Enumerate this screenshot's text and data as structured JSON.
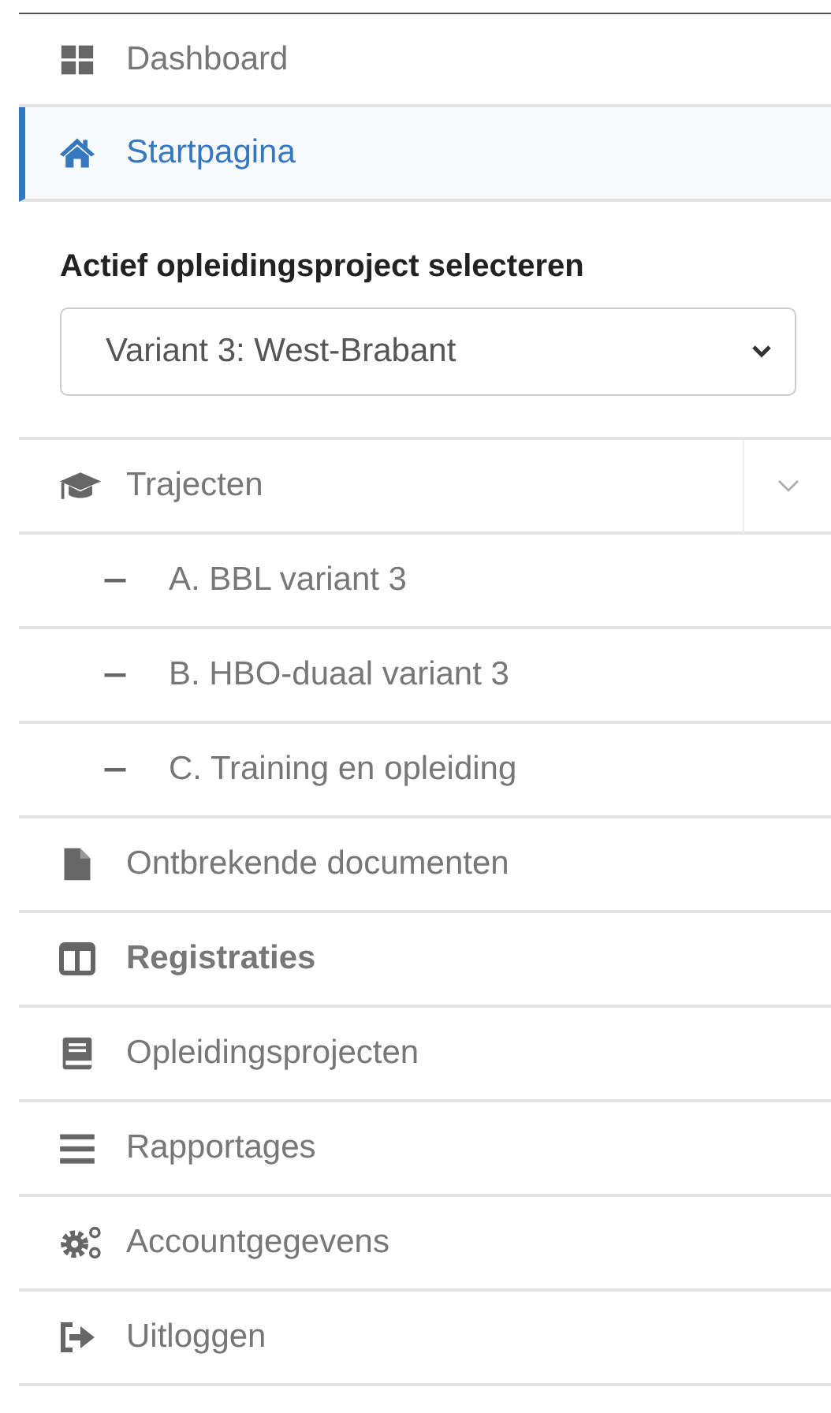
{
  "top_items": [
    {
      "label": "Dashboard",
      "selected": false
    },
    {
      "label": "Startpagina",
      "selected": true
    }
  ],
  "project_selector": {
    "label": "Actief opleidingsproject selecteren",
    "value": "Variant 3: West-Brabant"
  },
  "items": [
    {
      "label": "Trajecten",
      "selected": false,
      "bold": false,
      "expanded": true,
      "children": [
        {
          "label": "A. BBL variant 3"
        },
        {
          "label": "B. HBO-duaal variant 3"
        },
        {
          "label": "C. Training en opleiding"
        }
      ]
    },
    {
      "label": "Ontbrekende documenten",
      "selected": false,
      "bold": false
    },
    {
      "label": "Registraties",
      "selected": false,
      "bold": true
    },
    {
      "label": "Opleidingsprojecten",
      "selected": false,
      "bold": false
    },
    {
      "label": "Rapportages",
      "selected": false,
      "bold": false
    },
    {
      "label": "Accountgegevens",
      "selected": false,
      "bold": false
    },
    {
      "label": "Uitloggen",
      "selected": false,
      "bold": false
    }
  ]
}
